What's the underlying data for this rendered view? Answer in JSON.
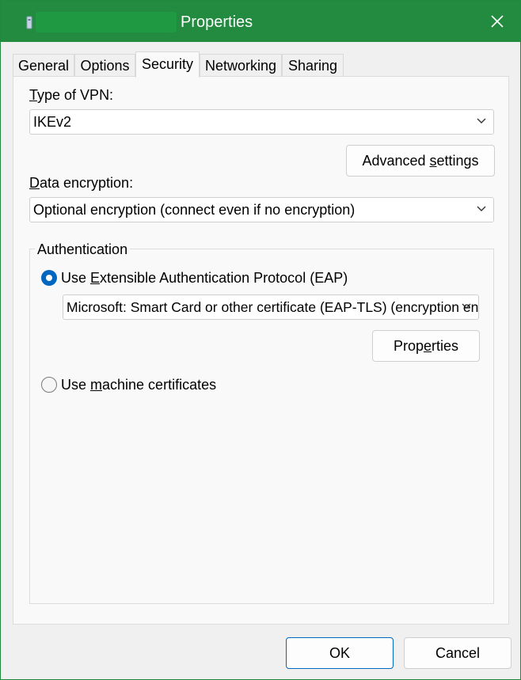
{
  "window": {
    "title": "Properties"
  },
  "tabs": [
    {
      "label": "General"
    },
    {
      "label": "Options"
    },
    {
      "label": "Security"
    },
    {
      "label": "Networking"
    },
    {
      "label": "Sharing"
    }
  ],
  "security": {
    "vpn_type_label": {
      "prefix": "",
      "accel": "T",
      "rest": "ype of VPN:"
    },
    "vpn_type_value": "IKEv2",
    "advanced": {
      "before": "Advanced ",
      "accel": "s",
      "after": "ettings"
    },
    "encryption_label": {
      "prefix": "",
      "accel": "D",
      "rest": "ata encryption:"
    },
    "encryption_value": "Optional encryption (connect even if no encryption)",
    "authentication": {
      "legend": "Authentication",
      "eap_radio": {
        "before": "Use ",
        "accel": "E",
        "after": "xtensible Authentication Protocol (EAP)",
        "checked": true
      },
      "eap_method": "Microsoft: Smart Card or other certificate (EAP-TLS) (encryption enabled)",
      "properties": {
        "before": "Prop",
        "accel": "e",
        "after": "rties"
      },
      "machine_radio": {
        "before": "Use ",
        "accel": "m",
        "after": "achine certificates",
        "checked": false
      }
    }
  },
  "footer": {
    "ok": "OK",
    "cancel": "Cancel"
  },
  "colors": {
    "titlebar": "#228b3f",
    "accent": "#0067c0"
  }
}
